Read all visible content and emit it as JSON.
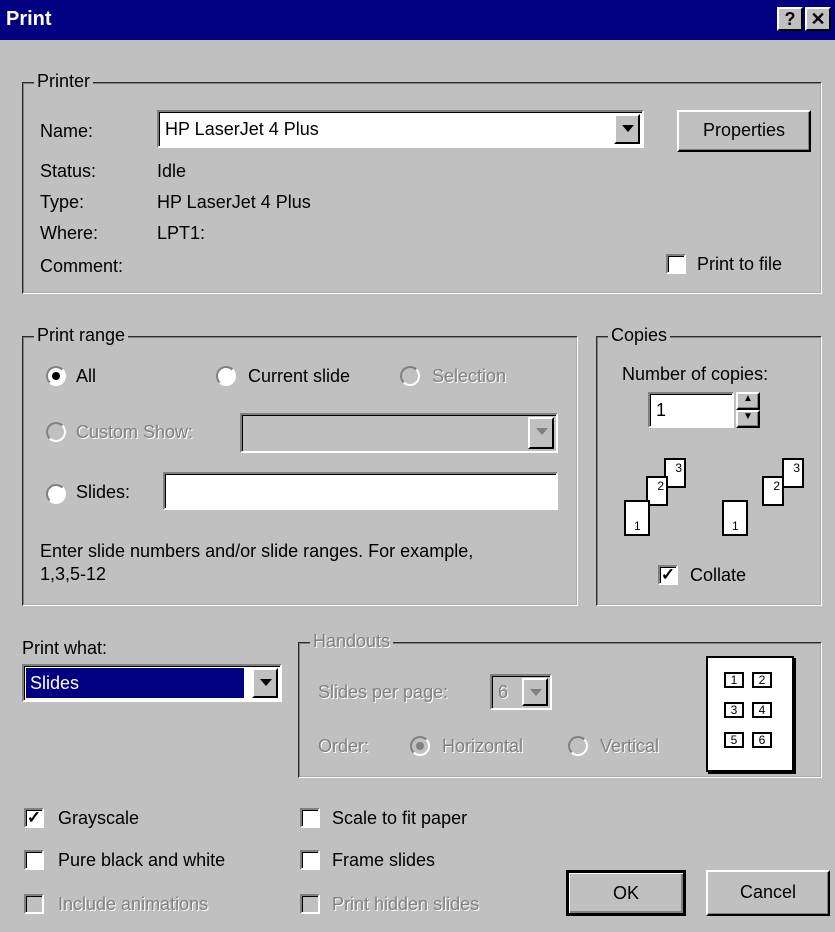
{
  "window": {
    "title": "Print"
  },
  "printer": {
    "group_label": "Printer",
    "name_label": "Name:",
    "name_value": "HP LaserJet 4 Plus",
    "properties_label": "Properties",
    "status_label": "Status:",
    "status_value": "Idle",
    "type_label": "Type:",
    "type_value": "HP LaserJet 4 Plus",
    "where_label": "Where:",
    "where_value": "LPT1:",
    "comment_label": "Comment:",
    "print_to_file_label": "Print to file",
    "print_to_file_checked": false
  },
  "print_range": {
    "group_label": "Print range",
    "all_label": "All",
    "current_slide_label": "Current slide",
    "selection_label": "Selection",
    "custom_show_label": "Custom Show:",
    "slides_label": "Slides:",
    "slides_value": "",
    "hint": "Enter slide numbers and/or slide ranges. For example,",
    "hint_example": "1,3,5-12",
    "selected": "All"
  },
  "copies": {
    "group_label": "Copies",
    "number_label": "Number of copies:",
    "number_value": "1",
    "collate_label": "Collate",
    "collate_checked": true
  },
  "print_what": {
    "label": "Print what:",
    "value": "Slides"
  },
  "handouts": {
    "group_label": "Handouts",
    "slides_per_page_label": "Slides per page:",
    "slides_per_page_value": "6",
    "order_label": "Order:",
    "horizontal_label": "Horizontal",
    "vertical_label": "Vertical",
    "preview_cells": [
      "1",
      "2",
      "3",
      "4",
      "5",
      "6"
    ]
  },
  "options": {
    "grayscale_label": "Grayscale",
    "grayscale_checked": true,
    "pure_bw_label": "Pure black and white",
    "include_animations_label": "Include animations",
    "scale_to_fit_label": "Scale to fit paper",
    "frame_slides_label": "Frame slides",
    "print_hidden_label": "Print hidden slides"
  },
  "buttons": {
    "ok": "OK",
    "cancel": "Cancel"
  },
  "colors": {
    "titlebar": "#000080",
    "face": "#c0c0c0",
    "disabled_text": "#808080",
    "selection": "#000080"
  }
}
